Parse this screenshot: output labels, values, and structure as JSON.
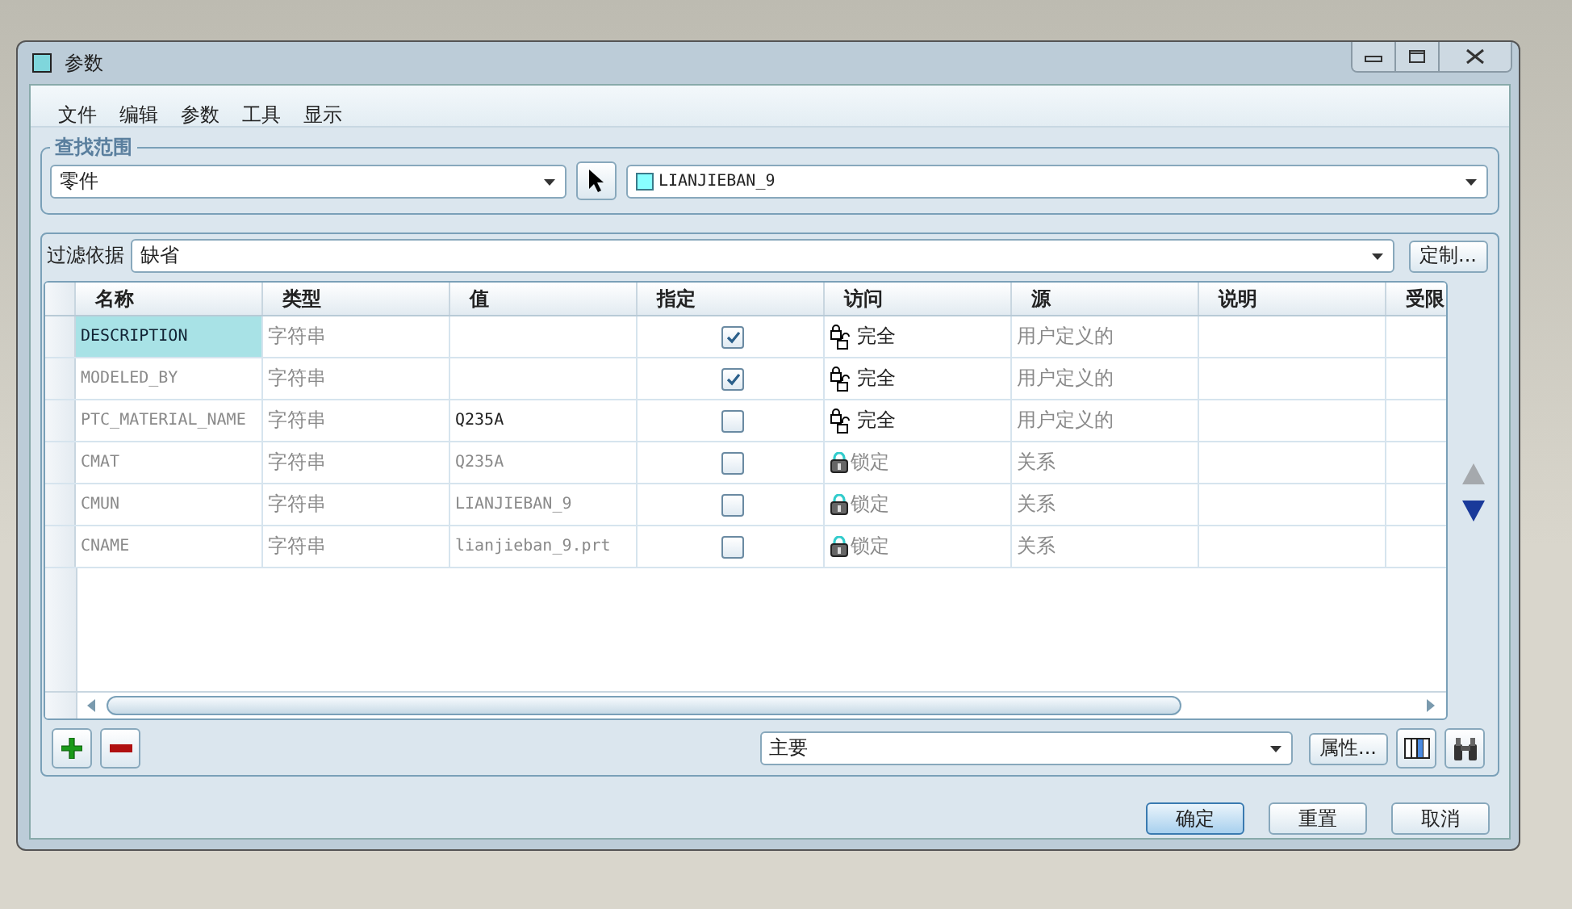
{
  "window": {
    "title": "参数"
  },
  "menu": [
    "文件",
    "编辑",
    "参数",
    "工具",
    "显示"
  ],
  "lookup": {
    "title": "查找范围",
    "scope": "零件",
    "model": "LIANJIEBAN_9"
  },
  "filter": {
    "label": "过滤依据",
    "value": "缺省",
    "button": "定制..."
  },
  "table": {
    "columns": [
      "名称",
      "类型",
      "值",
      "指定",
      "访问",
      "源",
      "说明",
      "受限"
    ],
    "rows": [
      {
        "name": "DESCRIPTION",
        "type": "字符串",
        "value": "",
        "designated": true,
        "access": {
          "kind": "full",
          "label": "完全"
        },
        "source": "用户定义的",
        "selected": true
      },
      {
        "name": "MODELED_BY",
        "type": "字符串",
        "value": "",
        "designated": true,
        "access": {
          "kind": "full",
          "label": "完全"
        },
        "source": "用户定义的",
        "selected": false
      },
      {
        "name": "PTC_MATERIAL_NAME",
        "type": "字符串",
        "value": "Q235A",
        "designated": false,
        "access": {
          "kind": "full",
          "label": "完全"
        },
        "source": "用户定义的",
        "selected": false
      },
      {
        "name": "CMAT",
        "type": "字符串",
        "value": "Q235A",
        "designated": false,
        "access": {
          "kind": "locked",
          "label": "锁定"
        },
        "source": "关系",
        "selected": false
      },
      {
        "name": "CMUN",
        "type": "字符串",
        "value": "LIANJIEBAN_9",
        "designated": false,
        "access": {
          "kind": "locked",
          "label": "锁定"
        },
        "source": "关系",
        "selected": false
      },
      {
        "name": "CNAME",
        "type": "字符串",
        "value": "lianjieban_9.prt",
        "designated": false,
        "access": {
          "kind": "locked",
          "label": "锁定"
        },
        "source": "关系",
        "selected": false
      }
    ]
  },
  "bottom": {
    "set": "主要",
    "properties": "属性..."
  },
  "buttons": [
    {
      "label": "确定",
      "default": true
    },
    {
      "label": "重置",
      "default": false
    },
    {
      "label": "取消",
      "default": false
    }
  ]
}
